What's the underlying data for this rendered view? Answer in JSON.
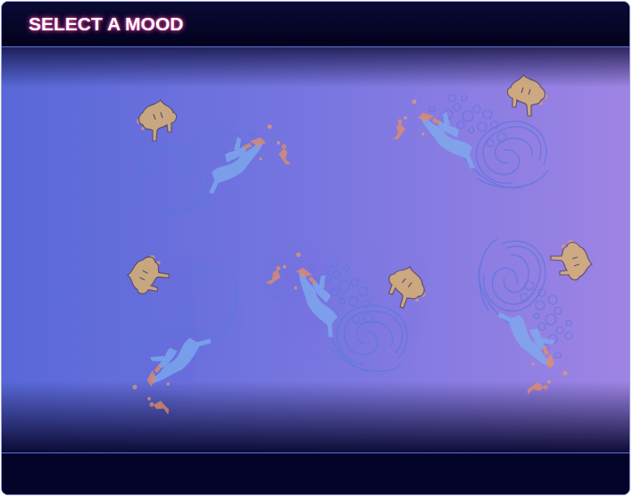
{
  "title": "SELECT A MOOD",
  "moods": [
    {
      "kind": "normal"
    },
    {
      "kind": "mirrored"
    },
    {
      "kind": "rotated"
    },
    {
      "kind": "flipped"
    },
    {
      "kind": "rotated-mirrored"
    }
  ]
}
